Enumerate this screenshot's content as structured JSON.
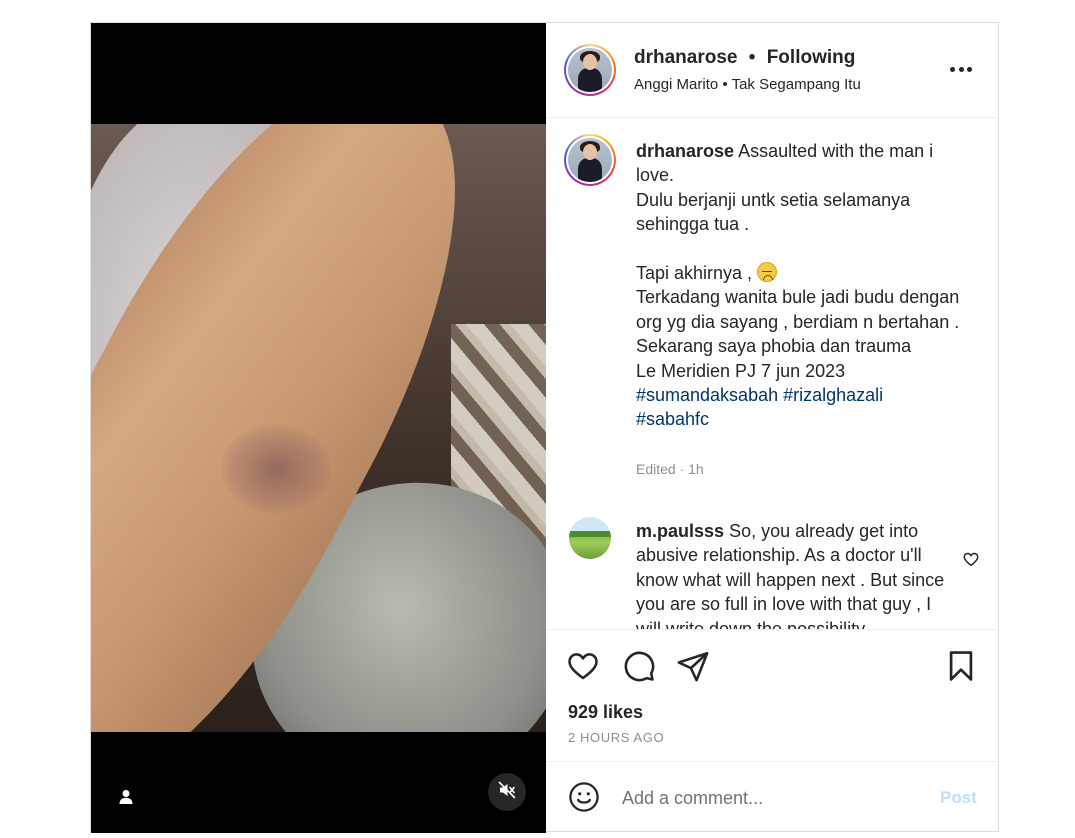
{
  "post": {
    "author": {
      "username": "drhanarose",
      "separator": "•",
      "follow_status": "Following",
      "audio_artist": "Anggi Marito",
      "audio_title": "Tak Segampang Itu"
    },
    "caption": {
      "username": "drhanarose",
      "line1": "Assaulted with the man i love.",
      "line2": "Dulu berjanji untk setia selamanya sehingga tua .",
      "line3": "Tapi akhirnya ,",
      "line4": "Terkadang wanita bule jadi budu dengan org yg dia sayang , berdiam n bertahan . Sekarang saya phobia dan trauma",
      "line5": "Le Meridien PJ 7 jun 2023",
      "hashtags": [
        "#sumandaksabah",
        "#rizalghazali",
        "#sabahfc"
      ],
      "emoji": "sad-face-emoji",
      "meta": "Edited · 1h"
    },
    "comments": [
      {
        "username": "m.paulsss",
        "text": "So, you already get into abusive relationship. As a doctor u'll know what will happen next . But since you are so full in love with that guy , I will write down the possibility"
      }
    ],
    "likes": "929 likes",
    "posted": "2 HOURS AGO",
    "add_comment": {
      "placeholder": "Add a comment...",
      "post_label": "Post"
    }
  },
  "icons": {
    "media_tag": "user-tag-icon",
    "mute": "speaker-muted-icon",
    "more": "more-options-icon",
    "like": "heart-icon",
    "comment": "comment-bubble-icon",
    "share": "paper-plane-icon",
    "save": "bookmark-icon",
    "emoji": "smiley-icon"
  },
  "colors": {
    "hashtag": "#00376b",
    "muted_text": "#8e8e8e",
    "post_button_disabled": "#c1def9",
    "border": "#dbdbdb"
  }
}
